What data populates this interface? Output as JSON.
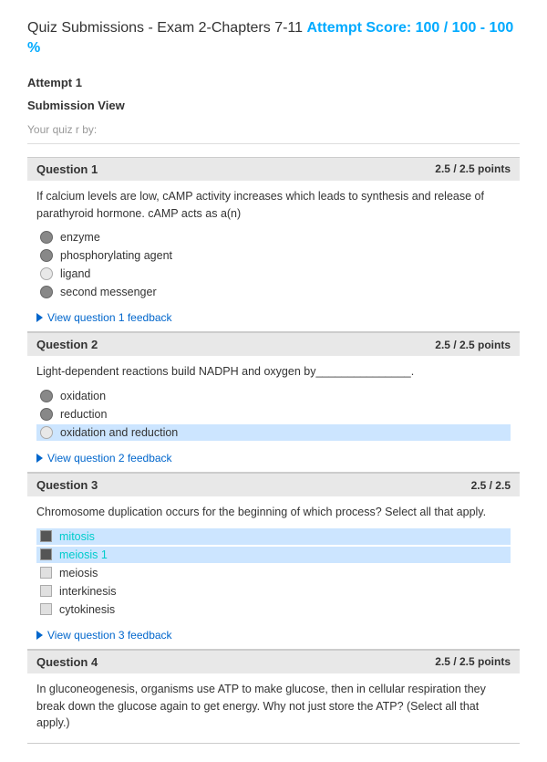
{
  "title": {
    "prefix": "Quiz Submissions - Exam 2-Chapters 7-11 ",
    "score_text": "Attempt Score: 100 / 100 - 100 %"
  },
  "attempt_label": "Attempt 1",
  "submission_view_label": "Submission View",
  "quiz_info": "Your quiz r                      by:",
  "questions": [
    {
      "id": "q1",
      "number": "Question 1",
      "points": "2.5 / 2.5 points",
      "text": "If calcium levels are low, cAMP activity increases which leads to synthesis and release of parathyroid hormone. cAMP acts as a(n)",
      "options": [
        {
          "label": "enzyme",
          "type": "radio",
          "state": "filled",
          "selected": false,
          "highlight": false
        },
        {
          "label": "phosphorylating  agent",
          "type": "radio",
          "state": "filled",
          "selected": false,
          "highlight": false
        },
        {
          "label": "ligand",
          "type": "radio",
          "state": "empty-light",
          "selected": false,
          "highlight": false
        },
        {
          "label": "second messenger",
          "type": "radio",
          "state": "filled",
          "selected": false,
          "highlight": false
        }
      ],
      "feedback_link": "View question 1 feedback"
    },
    {
      "id": "q2",
      "number": "Question 2",
      "points": "2.5 / 2.5 points",
      "text": "Light-dependent reactions build NADPH and oxygen by_______________.",
      "options": [
        {
          "label": "oxidation",
          "type": "radio",
          "state": "filled",
          "selected": false,
          "highlight": false
        },
        {
          "label": "reduction",
          "type": "radio",
          "state": "filled",
          "selected": false,
          "highlight": false
        },
        {
          "label": "oxidation and reduction",
          "type": "radio",
          "state": "empty-light",
          "selected": true,
          "highlight": true
        }
      ],
      "feedback_link": "View question 2 feedback"
    },
    {
      "id": "q3",
      "number": "Question 3",
      "points": "2.5 / 2.5",
      "text": "Chromosome duplication occurs for the beginning of which process? Select all that apply.",
      "options": [
        {
          "label": "mitosis",
          "type": "checkbox",
          "state": "filled",
          "selected": true,
          "highlight": true,
          "cyan": true
        },
        {
          "label": "meiosis 1",
          "type": "checkbox",
          "state": "filled",
          "selected": true,
          "highlight": true,
          "cyan": true
        },
        {
          "label": "meiosis",
          "type": "checkbox",
          "state": "light",
          "selected": false,
          "highlight": false
        },
        {
          "label": "interkinesis",
          "type": "checkbox",
          "state": "light",
          "selected": false,
          "highlight": false
        },
        {
          "label": "cytokinesis",
          "type": "checkbox",
          "state": "light",
          "selected": false,
          "highlight": false
        }
      ],
      "feedback_link": "View question 3 feedback"
    },
    {
      "id": "q4",
      "number": "Question 4",
      "points": "2.5 / 2.5 points",
      "text": "In gluconeogenesis, organisms use ATP to make glucose, then in cellular respiration they break down the glucose again to get energy. Why not just store the ATP? (Select all that apply.)"
    }
  ]
}
